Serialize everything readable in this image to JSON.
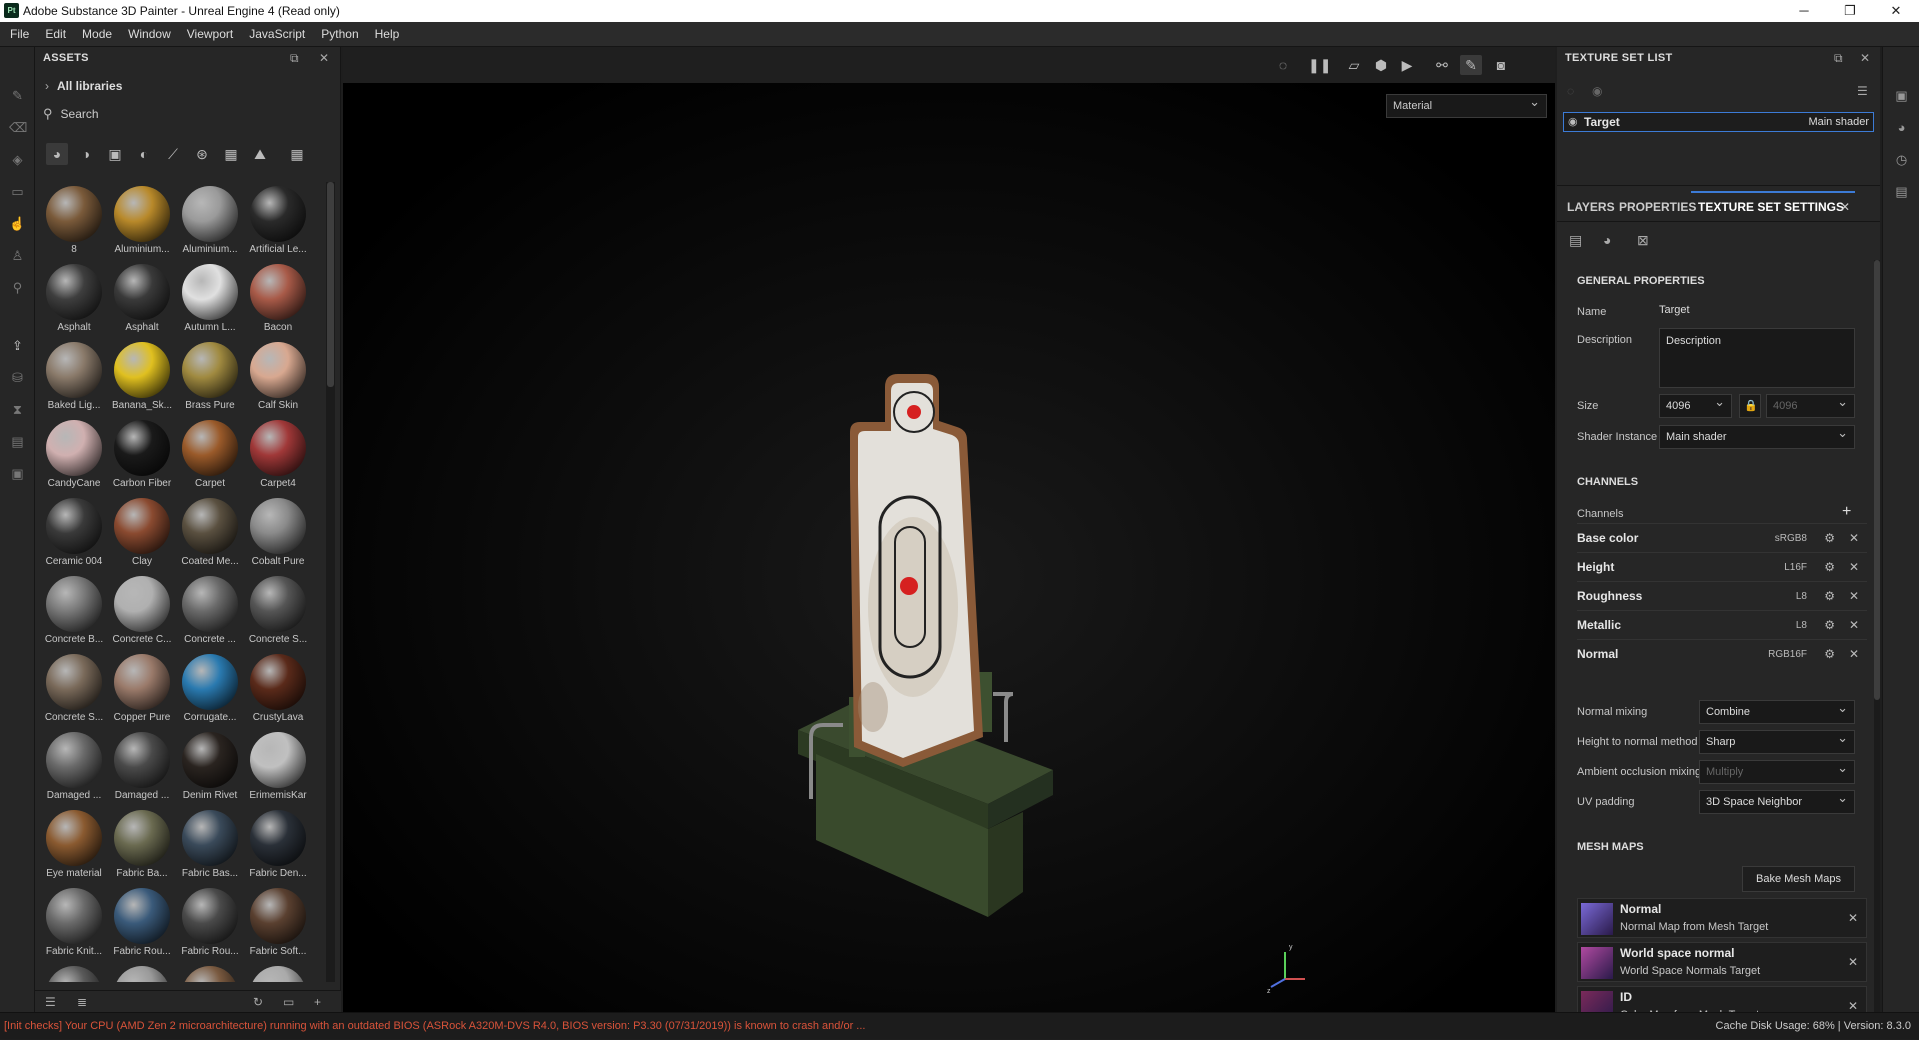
{
  "window": {
    "title": "Adobe Substance 3D Painter - Unreal Engine 4 (Read only)",
    "logo": "Pt",
    "minimize": "─",
    "maximize": "❐",
    "close": "✕"
  },
  "menu": [
    "File",
    "Edit",
    "Mode",
    "Window",
    "Viewport",
    "JavaScript",
    "Python",
    "Help"
  ],
  "assets": {
    "title": "ASSETS",
    "breadcrumb": "All libraries",
    "search_placeholder": "Search",
    "items": [
      {
        "label": "8",
        "color": "#7a5a3a"
      },
      {
        "label": "Aluminium...",
        "color": "#b8892a"
      },
      {
        "label": "Aluminium...",
        "color": "#9a9a9a"
      },
      {
        "label": "Artificial Le...",
        "color": "#2a2a2a"
      },
      {
        "label": "Asphalt",
        "color": "#3e3e3e"
      },
      {
        "label": "Asphalt",
        "color": "#3a3a3a"
      },
      {
        "label": "Autumn L...",
        "color": "#e0e0e0"
      },
      {
        "label": "Bacon",
        "color": "#a85a48"
      },
      {
        "label": "Baked Lig...",
        "color": "#8a7a6a"
      },
      {
        "label": "Banana_Sk...",
        "color": "#e0c020"
      },
      {
        "label": "Brass Pure",
        "color": "#a08a40"
      },
      {
        "label": "Calf Skin",
        "color": "#d8a890"
      },
      {
        "label": "CandyCane",
        "color": "#d0b0b0"
      },
      {
        "label": "Carbon Fiber",
        "color": "#1a1a1a"
      },
      {
        "label": "Carpet",
        "color": "#9a5a2a"
      },
      {
        "label": "Carpet4",
        "color": "#a03838"
      },
      {
        "label": "Ceramic 004",
        "color": "#3a3a3a"
      },
      {
        "label": "Clay",
        "color": "#8a4a30"
      },
      {
        "label": "Coated Me...",
        "color": "#5a5040"
      },
      {
        "label": "Cobalt Pure",
        "color": "#8a8a8a"
      },
      {
        "label": "Concrete B...",
        "color": "#7a7a7a"
      },
      {
        "label": "Concrete C...",
        "color": "#b0b0b0"
      },
      {
        "label": "Concrete ...",
        "color": "#6a6a6a"
      },
      {
        "label": "Concrete S...",
        "color": "#555555"
      },
      {
        "label": "Concrete S...",
        "color": "#7a6a5a"
      },
      {
        "label": "Copper Pure",
        "color": "#9a7a6a"
      },
      {
        "label": "Corrugate...",
        "color": "#2a7ab0"
      },
      {
        "label": "CrustyLava",
        "color": "#5a2a1a"
      },
      {
        "label": "Damaged ...",
        "color": "#6a6a6a"
      },
      {
        "label": "Damaged ...",
        "color": "#4a4a4a"
      },
      {
        "label": "Denim Rivet",
        "color": "#2a2420"
      },
      {
        "label": "ErimemisKar",
        "color": "#c0c0c0"
      },
      {
        "label": "Eye material",
        "color": "#8a5a30"
      },
      {
        "label": "Fabric Ba...",
        "color": "#6a6a50"
      },
      {
        "label": "Fabric Bas...",
        "color": "#3a4a5a"
      },
      {
        "label": "Fabric Den...",
        "color": "#2a3038"
      },
      {
        "label": "Fabric Knit...",
        "color": "#6a6a6a"
      },
      {
        "label": "Fabric Rou...",
        "color": "#3a5a7a"
      },
      {
        "label": "Fabric Rou...",
        "color": "#4a4a4a"
      },
      {
        "label": "Fabric Soft...",
        "color": "#5a4030"
      },
      {
        "label": "",
        "color": "#5a5a5a"
      },
      {
        "label": "",
        "color": "#9a9a9a"
      },
      {
        "label": "",
        "color": "#7a5a40"
      },
      {
        "label": "",
        "color": "#aaaaaa"
      }
    ]
  },
  "viewport": {
    "material_mode": "Material"
  },
  "texture_set_list": {
    "title": "TEXTURE SET LIST",
    "set_name": "Target",
    "shader": "Main shader"
  },
  "tabs": {
    "layers": "LAYERS",
    "properties": "PROPERTIES",
    "texture_set_settings": "TEXTURE SET SETTINGS"
  },
  "general": {
    "heading": "GENERAL PROPERTIES",
    "name_label": "Name",
    "name_value": "Target",
    "description_label": "Description",
    "description_value": "Description",
    "size_label": "Size",
    "size_value": "4096",
    "size_value2": "4096",
    "shader_instance_label": "Shader Instance",
    "shader_instance_value": "Main shader"
  },
  "channels": {
    "heading": "CHANNELS",
    "label": "Channels",
    "add": "+",
    "items": [
      {
        "name": "Base color",
        "format": "sRGB8"
      },
      {
        "name": "Height",
        "format": "L16F"
      },
      {
        "name": "Roughness",
        "format": "L8"
      },
      {
        "name": "Metallic",
        "format": "L8"
      },
      {
        "name": "Normal",
        "format": "RGB16F"
      }
    ],
    "normal_mixing_label": "Normal mixing",
    "normal_mixing_value": "Combine",
    "height_to_normal_label": "Height to normal method",
    "height_to_normal_value": "Sharp",
    "ao_mixing_label": "Ambient occlusion mixing",
    "ao_mixing_value": "Multiply",
    "uv_padding_label": "UV padding",
    "uv_padding_value": "3D Space Neighbor"
  },
  "mesh_maps": {
    "heading": "MESH MAPS",
    "bake_button": "Bake Mesh Maps",
    "items": [
      {
        "title": "Normal",
        "subtitle": "Normal Map from Mesh Target",
        "color": "#7a6ad8"
      },
      {
        "title": "World space normal",
        "subtitle": "World Space Normals Target",
        "color": "#b04aa0"
      },
      {
        "title": "ID",
        "subtitle": "Color Map from Mesh Target",
        "color": "#7a2a5a"
      }
    ]
  },
  "status": {
    "warning": "[Init checks] Your CPU (AMD Zen 2 microarchitecture) running with an outdated BIOS (ASRock A320M-DVS R4.0, BIOS version: P3.30 (07/31/2019)) is known to crash and/or ...",
    "cache": "Cache Disk Usage:   68% | Version: 8.3.0"
  }
}
